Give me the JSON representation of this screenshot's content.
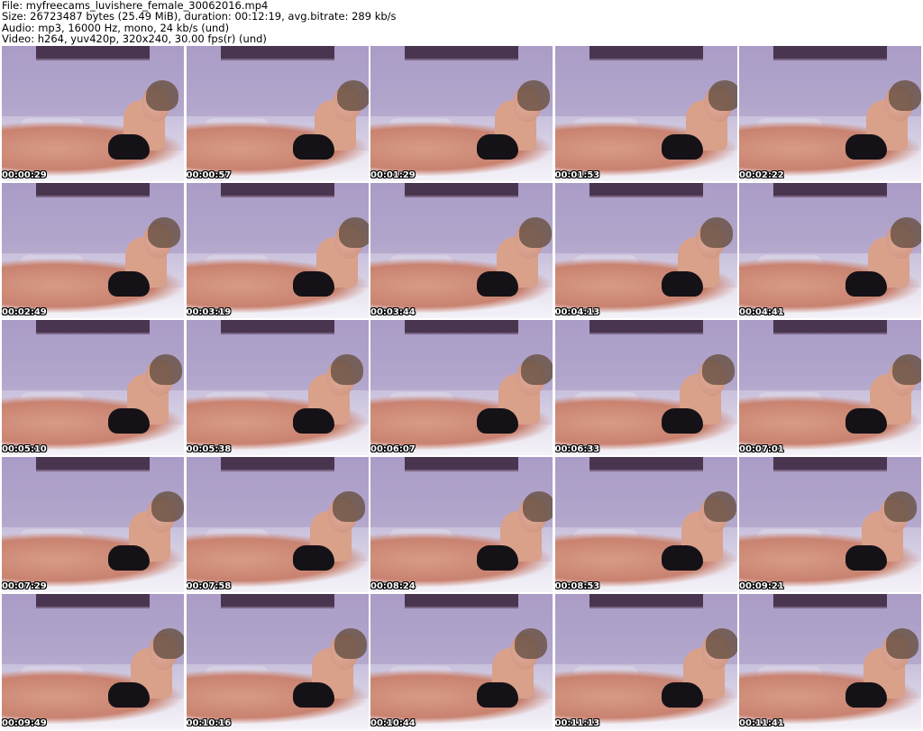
{
  "header": {
    "file_line": "File: myfreecams_luvishere_female_30062016.mp4",
    "size_line": "Size: 26723487 bytes (25.49 MiB), duration: 00:12:19, avg.bitrate: 289 kb/s",
    "audio_line": "Audio: mp3, 16000 Hz, mono, 24 kb/s (und)",
    "video_line": "Video: h264, yuv420p, 320x240, 30.00 fps(r) (und)"
  },
  "thumbnails": [
    {
      "timestamp": "00:00:29"
    },
    {
      "timestamp": "00:00:57"
    },
    {
      "timestamp": "00:01:29"
    },
    {
      "timestamp": "00:01:53"
    },
    {
      "timestamp": "00:02:22"
    },
    {
      "timestamp": "00:02:49"
    },
    {
      "timestamp": "00:03:19"
    },
    {
      "timestamp": "00:03:44"
    },
    {
      "timestamp": "00:04:13"
    },
    {
      "timestamp": "00:04:41"
    },
    {
      "timestamp": "00:05:10"
    },
    {
      "timestamp": "00:05:38"
    },
    {
      "timestamp": "00:06:07"
    },
    {
      "timestamp": "00:06:33"
    },
    {
      "timestamp": "00:07:01"
    },
    {
      "timestamp": "00:07:29"
    },
    {
      "timestamp": "00:07:58"
    },
    {
      "timestamp": "00:08:24"
    },
    {
      "timestamp": "00:08:53"
    },
    {
      "timestamp": "00:09:21"
    },
    {
      "timestamp": "00:09:49"
    },
    {
      "timestamp": "00:10:16"
    },
    {
      "timestamp": "00:10:44"
    },
    {
      "timestamp": "00:11:13"
    },
    {
      "timestamp": "00:11:41"
    }
  ]
}
